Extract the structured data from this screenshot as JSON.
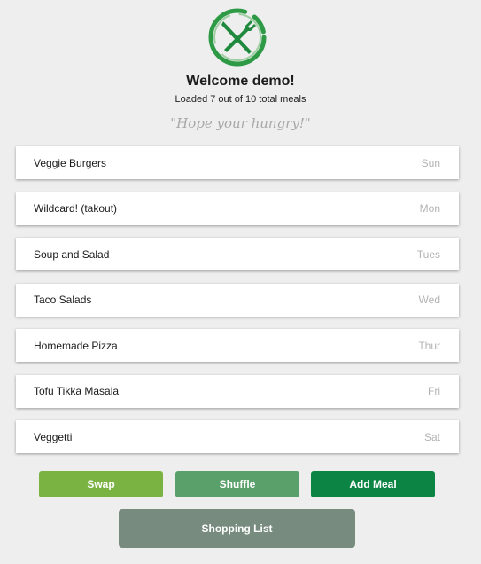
{
  "header": {
    "welcome": "Welcome demo!",
    "loaded_text": "Loaded 7 out of 10 total meals",
    "quote": "\"Hope your hungry!\"",
    "logo_icon": "fork-knife-icon"
  },
  "meals": [
    {
      "name": "Veggie Burgers",
      "day": "Sun"
    },
    {
      "name": "Wildcard! (takout)",
      "day": "Mon"
    },
    {
      "name": "Soup and Salad",
      "day": "Tues"
    },
    {
      "name": "Taco Salads",
      "day": "Wed"
    },
    {
      "name": "Homemade Pizza",
      "day": "Thur"
    },
    {
      "name": "Tofu Tikka Masala",
      "day": "Fri"
    },
    {
      "name": "Veggetti",
      "day": "Sat"
    }
  ],
  "actions": {
    "swap": "Swap",
    "shuffle": "Shuffle",
    "add_meal": "Add Meal",
    "shopping_list": "Shopping List"
  },
  "colors": {
    "background": "#eeeeee",
    "swap": "#7bb342",
    "shuffle": "#5aa06a",
    "add_meal": "#0c8444",
    "shopping_list": "#778c7f",
    "logo_green": "#2e9a46"
  }
}
